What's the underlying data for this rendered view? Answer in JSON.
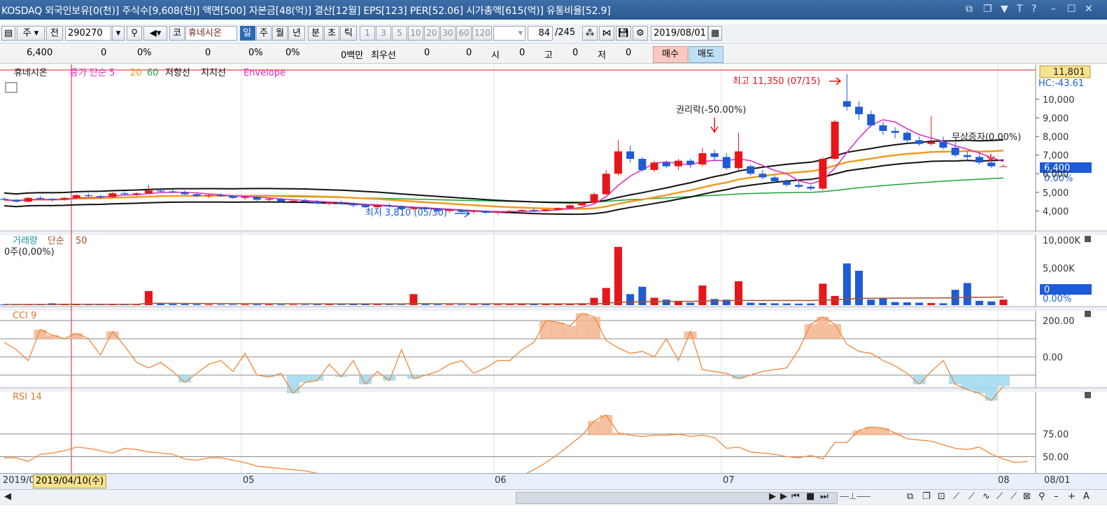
{
  "titlebar": {
    "text": "KOSDAQ 외국인보유[0(천)] 주식수[9,608(천)] 액면[500] 자본금[48(억)] 결산[12월] EPS[123] PER[52.06] 시가총액[615(억)] 유통비율[52.9]",
    "icons": [
      "restore-icon",
      "copy-icon",
      "pin-icon",
      "font-icon",
      "help-icon",
      "minimize-icon",
      "maximize-icon",
      "close-icon"
    ]
  },
  "toolbar": {
    "period_label": "주",
    "prev_label": "전",
    "code": "290270",
    "market_label": "코",
    "stock_name": "휴네시온",
    "intervals": [
      "일",
      "주",
      "월",
      "년",
      "분",
      "초",
      "틱"
    ],
    "selected_interval": "일",
    "minutes": [
      "1",
      "3",
      "5",
      "10",
      "20",
      "30",
      "60",
      "120"
    ],
    "count": "84",
    "total": "/245",
    "date": "2019/08/01"
  },
  "quote": {
    "price": "6,400",
    "change": "0",
    "change_pct": "0%",
    "volume": "0",
    "vol_pct": "0%",
    "vol_pct2": "0%",
    "amount": "0백만",
    "best_label": "최우선",
    "best1": "0",
    "best2": "0",
    "open_label": "시",
    "open": "0",
    "high_label": "고",
    "high": "0",
    "low_label": "저",
    "low": "0",
    "buy_label": "매수",
    "sell_label": "매도"
  },
  "colors": {
    "up": "#e8151b",
    "down": "#1e5bd6",
    "ma5": "#d629c8",
    "ma20": "#f29a1f",
    "ma60": "#1fa33a",
    "resist": "#111111",
    "cci_fill_pos": "#f5b58f",
    "cci_fill_neg": "#9fd8ef",
    "line": "#f0883a"
  },
  "chart_data": [
    {
      "type": "candlestick",
      "panel": "price",
      "legend": [
        "휴네시온",
        "종가 단순 5",
        "20",
        "60",
        "저항선",
        "지지선",
        "Envelope"
      ],
      "y_ticks": [
        "10,000",
        "9,000",
        "8,000",
        "7,000",
        "6,000",
        "5,000",
        "4,000"
      ],
      "y_range": [
        3000,
        11801
      ],
      "top_label": "11,801",
      "top_right_label": "HC:-43.61",
      "current_price_label": "6,400",
      "current_pct_label": "0.00%",
      "annotations": {
        "high": "최고 11,350 (07/15)",
        "low": "최저 3,810 (05/30)",
        "rights": "권리락(-50.00%)",
        "increase": "무상증자(0.00%)"
      },
      "x_labels": [
        "2019/0",
        "05",
        "06",
        "07",
        "08",
        "08/01"
      ],
      "cursor_date": "2019/04/10(수)",
      "candles_ohlc": [
        [
          4650,
          4750,
          4550,
          4600
        ],
        [
          4600,
          4650,
          4450,
          4500
        ],
        [
          4500,
          4750,
          4450,
          4700
        ],
        [
          4700,
          4800,
          4600,
          4650
        ],
        [
          4650,
          4700,
          4500,
          4600
        ],
        [
          4600,
          4750,
          4550,
          4700
        ],
        [
          4700,
          4900,
          4650,
          4850
        ],
        [
          4850,
          4950,
          4750,
          4800
        ],
        [
          4800,
          4850,
          4650,
          4750
        ],
        [
          4750,
          5000,
          4700,
          4950
        ],
        [
          4950,
          5050,
          4850,
          4900
        ],
        [
          4900,
          5000,
          4800,
          4950
        ],
        [
          4950,
          5400,
          4900,
          5100
        ],
        [
          5100,
          5250,
          5000,
          5050
        ],
        [
          5050,
          5150,
          4950,
          5000
        ],
        [
          5000,
          5100,
          4850,
          4900
        ],
        [
          4900,
          4950,
          4750,
          4800
        ],
        [
          4800,
          4900,
          4700,
          4850
        ],
        [
          4850,
          4950,
          4750,
          4800
        ],
        [
          4800,
          4850,
          4650,
          4700
        ],
        [
          4700,
          4800,
          4600,
          4750
        ],
        [
          4750,
          4800,
          4550,
          4600
        ],
        [
          4600,
          4700,
          4500,
          4650
        ],
        [
          4650,
          4700,
          4450,
          4500
        ],
        [
          4500,
          4600,
          4400,
          4550
        ],
        [
          4550,
          4650,
          4450,
          4500
        ],
        [
          4500,
          4600,
          4350,
          4400
        ],
        [
          4400,
          4500,
          4300,
          4450
        ],
        [
          4450,
          4550,
          4350,
          4400
        ],
        [
          4400,
          4450,
          4200,
          4300
        ],
        [
          4300,
          4400,
          4150,
          4200
        ],
        [
          4200,
          4350,
          4100,
          4300
        ],
        [
          4300,
          4400,
          4200,
          4250
        ],
        [
          4250,
          4300,
          4050,
          4100
        ],
        [
          4100,
          4200,
          4000,
          4150
        ],
        [
          4150,
          4250,
          4050,
          4100
        ],
        [
          4100,
          4150,
          3950,
          4000
        ],
        [
          4000,
          4100,
          3900,
          4050
        ],
        [
          4050,
          4100,
          3900,
          3950
        ],
        [
          3950,
          4050,
          3850,
          4000
        ],
        [
          4000,
          4050,
          3860,
          3900
        ],
        [
          3900,
          4000,
          3810,
          3950
        ],
        [
          3950,
          4050,
          3900,
          4000
        ],
        [
          4000,
          4100,
          3950,
          4050
        ],
        [
          4050,
          4150,
          3950,
          4000
        ],
        [
          4000,
          4100,
          3950,
          4080
        ],
        [
          4080,
          4200,
          4000,
          4150
        ],
        [
          4150,
          4350,
          4100,
          4300
        ],
        [
          4300,
          4500,
          4250,
          4450
        ],
        [
          4450,
          5000,
          4400,
          4900
        ],
        [
          4900,
          6200,
          4850,
          6000
        ],
        [
          6000,
          7800,
          5900,
          7200
        ],
        [
          7200,
          7500,
          6600,
          6800
        ],
        [
          6800,
          6900,
          6100,
          6200
        ],
        [
          6200,
          6700,
          6100,
          6600
        ],
        [
          6600,
          6700,
          6300,
          6400
        ],
        [
          6400,
          6800,
          6200,
          6700
        ],
        [
          6700,
          6800,
          6300,
          6500
        ],
        [
          6500,
          7400,
          6400,
          7100
        ],
        [
          7100,
          7300,
          6700,
          6900
        ],
        [
          6900,
          7100,
          6200,
          6300
        ],
        [
          6300,
          8200,
          6200,
          7200
        ],
        [
          6400,
          6500,
          5900,
          6000
        ],
        [
          6000,
          6200,
          5700,
          5800
        ],
        [
          5800,
          5900,
          5500,
          5600
        ],
        [
          5600,
          5700,
          5300,
          5400
        ],
        [
          5400,
          5600,
          5200,
          5300
        ],
        [
          5300,
          5400,
          5100,
          5200
        ],
        [
          5200,
          6900,
          5100,
          6800
        ],
        [
          6800,
          8900,
          6700,
          8800
        ],
        [
          9900,
          11350,
          9400,
          9600
        ],
        [
          9600,
          9900,
          8900,
          9200
        ],
        [
          9200,
          9400,
          8500,
          8600
        ],
        [
          8600,
          8800,
          8100,
          8300
        ],
        [
          8300,
          8500,
          7900,
          8200
        ],
        [
          8200,
          8300,
          7700,
          7800
        ],
        [
          7800,
          8000,
          7500,
          7600
        ],
        [
          7600,
          9100,
          7500,
          7700
        ],
        [
          7700,
          8000,
          7300,
          7400
        ],
        [
          7400,
          7700,
          6900,
          7000
        ],
        [
          7000,
          7200,
          6700,
          6900
        ],
        [
          6900,
          7100,
          6500,
          6600
        ],
        [
          6600,
          6700,
          6300,
          6400
        ],
        [
          6400,
          6500,
          6400,
          6400
        ]
      ]
    },
    {
      "type": "bar",
      "panel": "volume",
      "legend": [
        "거래량",
        "단순",
        "50"
      ],
      "info": "0주(0,00%)",
      "y_ticks": [
        "10,000K",
        "5,000K",
        "0.00%"
      ],
      "current_label": "0",
      "values_k": [
        120,
        80,
        150,
        90,
        300,
        100,
        120,
        80,
        140,
        160,
        100,
        90,
        2300,
        350,
        200,
        180,
        150,
        120,
        90,
        100,
        110,
        130,
        120,
        100,
        90,
        80,
        110,
        100,
        90,
        120,
        140,
        100,
        90,
        80,
        1800,
        150,
        120,
        100,
        90,
        110,
        130,
        100,
        120,
        150,
        140,
        160,
        200,
        250,
        300,
        1200,
        2800,
        9500,
        1800,
        3000,
        1200,
        900,
        700,
        400,
        3200,
        1000,
        900,
        3900,
        400,
        350,
        300,
        280,
        250,
        270,
        3500,
        1500,
        6800,
        5600,
        900,
        1100,
        500,
        450,
        400,
        350,
        300,
        2500,
        3600,
        700,
        600,
        900
      ]
    },
    {
      "type": "line",
      "panel": "cci",
      "legend": "CCI 9",
      "y_ticks": [
        "200.00",
        "0.00"
      ],
      "values": [
        80,
        40,
        -20,
        150,
        120,
        100,
        130,
        100,
        10,
        140,
        60,
        -30,
        -60,
        -30,
        -80,
        -140,
        -90,
        -40,
        -20,
        -80,
        20,
        -100,
        -110,
        -90,
        -200,
        -140,
        -130,
        -40,
        -110,
        -20,
        -150,
        -80,
        -130,
        40,
        -120,
        -100,
        -80,
        -40,
        -20,
        -90,
        -60,
        -20,
        -20,
        40,
        80,
        200,
        190,
        170,
        240,
        220,
        90,
        50,
        20,
        30,
        0,
        100,
        -20,
        140,
        -70,
        -80,
        -90,
        -120,
        -100,
        -80,
        -70,
        -60,
        40,
        180,
        220,
        180,
        70,
        30,
        20,
        -20,
        -50,
        -90,
        -150,
        -80,
        -20,
        -150,
        -180,
        -200,
        -240,
        -160
      ]
    },
    {
      "type": "line",
      "panel": "rsi",
      "legend": "RSI 14",
      "y_ticks": [
        "75.00",
        "50.00"
      ],
      "values": [
        49,
        49,
        46,
        52,
        53,
        55,
        58,
        57,
        55,
        53,
        57,
        56,
        54,
        53,
        52,
        48,
        47,
        49,
        49,
        47,
        45,
        42,
        41,
        40,
        39,
        38,
        36,
        35,
        34,
        32,
        31,
        30,
        33,
        30,
        29,
        28,
        30,
        28,
        27,
        26,
        27,
        36,
        35,
        34,
        39,
        45,
        52,
        60,
        68,
        80,
        85,
        70,
        68,
        67,
        68,
        68,
        69,
        67,
        68,
        66,
        57,
        58,
        54,
        53,
        52,
        50,
        49,
        51,
        48,
        62,
        62,
        72,
        75,
        74,
        70,
        65,
        64,
        63,
        60,
        57,
        56,
        58,
        52,
        48,
        45,
        46
      ]
    }
  ],
  "scrollbar": {
    "controls": [
      "scroll-left-icon",
      "scroll-right-icon",
      "first-icon",
      "prev-icon",
      "stop-icon",
      "next-icon",
      "zoom-slider",
      "tool-icons",
      "magnifier-icon",
      "zoom-in-icon",
      "zoom-out-icon",
      "auto-label"
    ],
    "auto_label": "A"
  }
}
